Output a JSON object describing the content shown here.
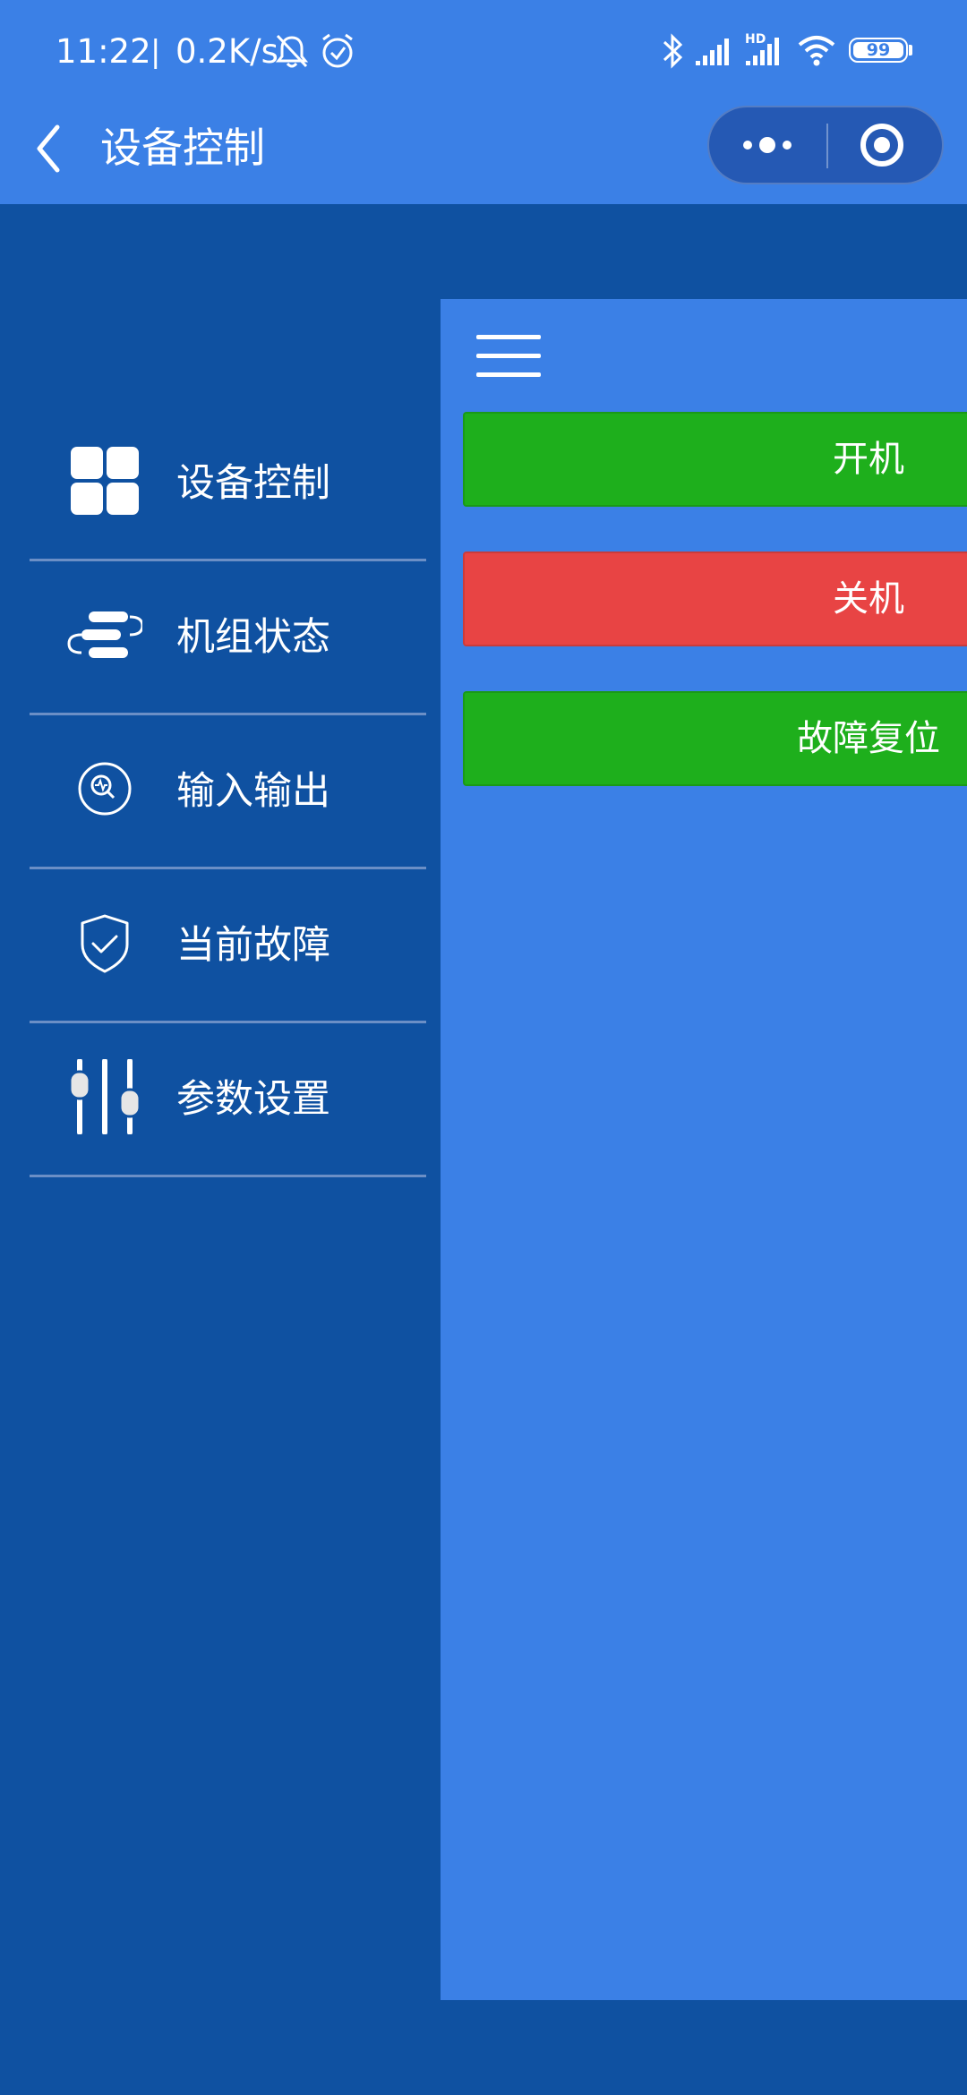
{
  "status_bar": {
    "time": "11:22",
    "separator": "|",
    "network_speed": "0.2K/s",
    "battery": "99",
    "network_badge": "HD",
    "icons": [
      "mute-bell-icon",
      "alarm-clock-icon",
      "bluetooth-icon",
      "signal-icon",
      "signal-hd-icon",
      "wifi-icon",
      "battery-icon"
    ]
  },
  "nav": {
    "title": "设备控制",
    "back_icon": "chevron-left-icon",
    "capsule_more_icon": "more-dots-icon",
    "capsule_close_icon": "target-close-icon"
  },
  "sidebar": {
    "items": [
      {
        "label": "设备控制",
        "icon": "grid-icon"
      },
      {
        "label": "机组状态",
        "icon": "unit-status-icon"
      },
      {
        "label": "输入输出",
        "icon": "io-monitor-icon"
      },
      {
        "label": "当前故障",
        "icon": "shield-check-icon"
      },
      {
        "label": "参数设置",
        "icon": "sliders-icon"
      }
    ]
  },
  "main": {
    "menu_icon": "hamburger-menu-icon",
    "buttons": [
      {
        "label": "开机",
        "color": "#1eaf1c"
      },
      {
        "label": "关机",
        "color": "#e84444"
      },
      {
        "label": "故障复位",
        "color": "#1eaf1c"
      }
    ]
  },
  "colors": {
    "header": "#3b80e6",
    "sidebar": "#0f51a1",
    "panel": "#3b80e6",
    "start": "#1eaf1c",
    "stop": "#e84444"
  }
}
